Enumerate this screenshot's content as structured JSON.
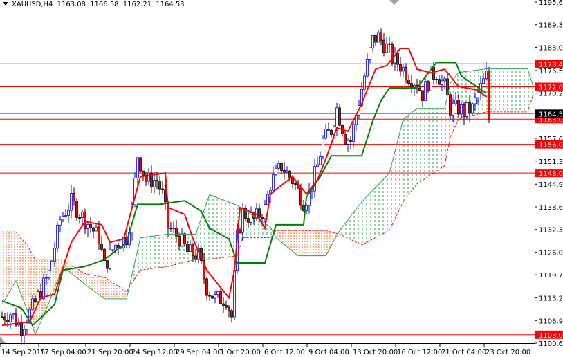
{
  "header": {
    "symbol": "XAUUSD,H4",
    "open": "1163.08",
    "high": "1166.58",
    "low": "1162.21",
    "close": "1164.53"
  },
  "colors": {
    "bull": "#0000ff",
    "bear": "#ff0000",
    "tenkan": "#ff0000",
    "kijun": "#008000",
    "cloud_bull": "#2ca05a",
    "cloud_bear": "#ff5a00",
    "level": "#ff0000",
    "current": "#708090"
  },
  "chart_data": {
    "type": "candlestick",
    "title": "XAUUSD,H4",
    "ylim": [
      1100.65,
      1195.6
    ],
    "y_ticks": [
      "1195.60",
      "1189.30",
      "1183.00",
      "1176.55",
      "1170.25",
      "1157.65",
      "1151.35",
      "1144.90",
      "1138.60",
      "1132.30",
      "1126.00",
      "1119.70",
      "1113.25",
      "1106.95",
      "1100.65"
    ],
    "x_labels": [
      {
        "bar": 0,
        "label": "14 Sep 2015"
      },
      {
        "bar": 15,
        "label": "17 Sep 04:00"
      },
      {
        "bar": 32,
        "label": "21 Sep 20:00"
      },
      {
        "bar": 48,
        "label": "24 Sep 12:00"
      },
      {
        "bar": 64,
        "label": "29 Sep 04:00"
      },
      {
        "bar": 80,
        "label": "1 Oct 20:00"
      },
      {
        "bar": 96,
        "label": "6 Oct 12:00"
      },
      {
        "bar": 112,
        "label": "9 Oct 04:00"
      },
      {
        "bar": 128,
        "label": "13 Oct 20:00"
      },
      {
        "bar": 144,
        "label": "16 Oct 12:00"
      },
      {
        "bar": 160,
        "label": "21 Oct 04:00"
      },
      {
        "bar": 176,
        "label": "23 Oct 20:00"
      }
    ],
    "levels": [
      {
        "price": 1178.4,
        "label": "1178.40"
      },
      {
        "price": 1172.0,
        "label": "1172.00"
      },
      {
        "price": 1163.0,
        "label": "1163.00"
      },
      {
        "price": 1156.0,
        "label": "1156.00"
      },
      {
        "price": 1148.0,
        "label": "1148.00"
      },
      {
        "price": 1103.0,
        "label": "1103.00"
      }
    ],
    "current_price": {
      "price": 1164.53,
      "label": "1164.53"
    },
    "price_path": [
      [
        0,
        1108
      ],
      [
        3,
        1109
      ],
      [
        7,
        1105
      ],
      [
        12,
        1112
      ],
      [
        17,
        1120
      ],
      [
        21,
        1135
      ],
      [
        25,
        1140
      ],
      [
        30,
        1135
      ],
      [
        35,
        1130
      ],
      [
        37,
        1122
      ],
      [
        41,
        1128
      ],
      [
        45,
        1130
      ],
      [
        47,
        1138
      ],
      [
        49,
        1153
      ],
      [
        52,
        1146
      ],
      [
        56,
        1146
      ],
      [
        58,
        1142
      ],
      [
        60,
        1133
      ],
      [
        64,
        1130
      ],
      [
        67,
        1126
      ],
      [
        71,
        1125
      ],
      [
        74,
        1116
      ],
      [
        77,
        1113
      ],
      [
        81,
        1113
      ],
      [
        83,
        1108
      ],
      [
        85,
        1130
      ],
      [
        87,
        1137
      ],
      [
        91,
        1135
      ],
      [
        95,
        1138
      ],
      [
        97,
        1145
      ],
      [
        101,
        1150
      ],
      [
        105,
        1146
      ],
      [
        109,
        1140
      ],
      [
        111,
        1142
      ],
      [
        114,
        1150
      ],
      [
        116,
        1157
      ],
      [
        119,
        1160
      ],
      [
        121,
        1166
      ],
      [
        124,
        1158
      ],
      [
        126,
        1157
      ],
      [
        129,
        1168
      ],
      [
        131,
        1175
      ],
      [
        134,
        1185
      ],
      [
        136,
        1186
      ],
      [
        139,
        1183
      ],
      [
        141,
        1180
      ],
      [
        144,
        1178
      ],
      [
        147,
        1175
      ],
      [
        150,
        1173
      ],
      [
        152,
        1170
      ],
      [
        155,
        1175
      ],
      [
        157,
        1176
      ],
      [
        160,
        1172
      ],
      [
        162,
        1166
      ],
      [
        165,
        1166
      ],
      [
        167,
        1165
      ],
      [
        170,
        1166
      ],
      [
        172,
        1170
      ],
      [
        175,
        1175
      ],
      [
        176,
        1163
      ]
    ],
    "tenkan": [
      [
        0,
        1105.6
      ],
      [
        10,
        1106.6
      ],
      [
        14,
        1113.3
      ],
      [
        19,
        1114.3
      ],
      [
        25,
        1128.7
      ],
      [
        30,
        1134.5
      ],
      [
        36,
        1133.6
      ],
      [
        39,
        1128.7
      ],
      [
        44,
        1129.7
      ],
      [
        47,
        1138.4
      ],
      [
        50,
        1147.0
      ],
      [
        59,
        1148.0
      ],
      [
        60,
        1138.4
      ],
      [
        66,
        1136.5
      ],
      [
        69,
        1129.7
      ],
      [
        74,
        1121.0
      ],
      [
        80,
        1115.2
      ],
      [
        82,
        1113.3
      ],
      [
        84,
        1121.0
      ],
      [
        86,
        1138.4
      ],
      [
        92,
        1136.5
      ],
      [
        95,
        1132.6
      ],
      [
        97,
        1142.2
      ],
      [
        105,
        1147.0
      ],
      [
        110,
        1142.2
      ],
      [
        114,
        1146.1
      ],
      [
        117,
        1151.9
      ],
      [
        121,
        1160.6
      ],
      [
        125,
        1159.6
      ],
      [
        130,
        1167.3
      ],
      [
        135,
        1176.9
      ],
      [
        139,
        1177.9
      ],
      [
        144,
        1182.7
      ],
      [
        147,
        1182.7
      ],
      [
        150,
        1176.9
      ],
      [
        155,
        1175.9
      ],
      [
        160,
        1176.9
      ],
      [
        165,
        1172.1
      ],
      [
        172,
        1171.1
      ],
      [
        175,
        1169.2
      ]
    ],
    "kijun": [
      [
        0,
        1112.4
      ],
      [
        7,
        1110.4
      ],
      [
        11,
        1105.6
      ],
      [
        19,
        1111.4
      ],
      [
        22,
        1121.0
      ],
      [
        30,
        1122.0
      ],
      [
        37,
        1123.9
      ],
      [
        45,
        1128.7
      ],
      [
        49,
        1139.3
      ],
      [
        57,
        1139.3
      ],
      [
        66,
        1140.3
      ],
      [
        72,
        1137.4
      ],
      [
        75,
        1132.6
      ],
      [
        82,
        1129.7
      ],
      [
        85,
        1123.0
      ],
      [
        95,
        1123.0
      ],
      [
        99,
        1133.6
      ],
      [
        109,
        1133.6
      ],
      [
        110,
        1141.3
      ],
      [
        115,
        1147.0
      ],
      [
        119,
        1152.8
      ],
      [
        130,
        1152.8
      ],
      [
        134,
        1162.5
      ],
      [
        137,
        1168.2
      ],
      [
        140,
        1171.7
      ],
      [
        150,
        1171.7
      ],
      [
        157,
        1178.8
      ],
      [
        164,
        1178.8
      ],
      [
        166,
        1175.0
      ],
      [
        175,
        1170.2
      ]
    ],
    "span_a": [
      [
        0,
        1111.4
      ],
      [
        5,
        1118
      ],
      [
        9,
        1110
      ],
      [
        12,
        1103
      ],
      [
        17,
        1112
      ],
      [
        22,
        1122
      ],
      [
        30,
        1117
      ],
      [
        37,
        1113
      ],
      [
        45,
        1113
      ],
      [
        50,
        1130
      ],
      [
        60,
        1131
      ],
      [
        70,
        1131
      ],
      [
        75,
        1142
      ],
      [
        85,
        1139
      ],
      [
        87,
        1138
      ],
      [
        97,
        1133
      ],
      [
        99,
        1130
      ],
      [
        107,
        1125
      ],
      [
        117,
        1125
      ],
      [
        122,
        1132
      ],
      [
        130,
        1140
      ],
      [
        140,
        1148
      ],
      [
        145,
        1163
      ],
      [
        150,
        1166
      ],
      [
        160,
        1166
      ],
      [
        162,
        1173
      ],
      [
        165,
        1176
      ],
      [
        175,
        1177
      ],
      [
        190,
        1177
      ],
      [
        192,
        1172
      ]
    ],
    "span_b": [
      [
        0,
        1131.6
      ],
      [
        5,
        1131.6
      ],
      [
        9,
        1128
      ],
      [
        12,
        1124
      ],
      [
        17,
        1124
      ],
      [
        22,
        1124
      ],
      [
        30,
        1120
      ],
      [
        37,
        1119
      ],
      [
        45,
        1115
      ],
      [
        50,
        1121
      ],
      [
        60,
        1122
      ],
      [
        70,
        1124
      ],
      [
        75,
        1124
      ],
      [
        85,
        1125
      ],
      [
        87,
        1130
      ],
      [
        97,
        1130
      ],
      [
        99,
        1132
      ],
      [
        107,
        1132
      ],
      [
        117,
        1132
      ],
      [
        122,
        1131
      ],
      [
        130,
        1128
      ],
      [
        140,
        1132
      ],
      [
        145,
        1140
      ],
      [
        150,
        1145
      ],
      [
        160,
        1150
      ],
      [
        162,
        1158
      ],
      [
        165,
        1163
      ],
      [
        175,
        1165
      ],
      [
        190,
        1165
      ],
      [
        192,
        1170
      ]
    ]
  }
}
